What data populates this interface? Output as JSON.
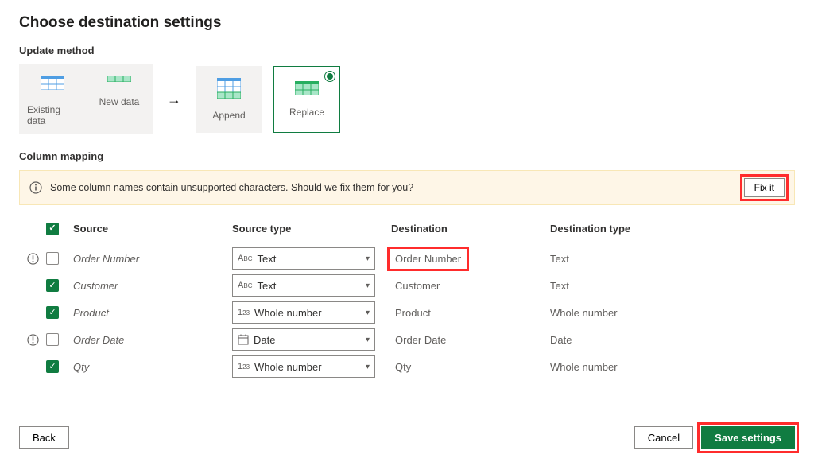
{
  "title": "Choose destination settings",
  "sections": {
    "update_method": "Update method",
    "column_mapping": "Column mapping"
  },
  "method": {
    "existing_data": "Existing data",
    "new_data": "New data",
    "append": "Append",
    "replace": "Replace"
  },
  "alert": {
    "message": "Some column names contain unsupported characters. Should we fix them for you?",
    "fix_label": "Fix it"
  },
  "table": {
    "headers": {
      "source": "Source",
      "source_type": "Source type",
      "destination": "Destination",
      "destination_type": "Destination type"
    },
    "rows": [
      {
        "checked": false,
        "warn": true,
        "source": "Order Number",
        "source_type": {
          "label": "Text",
          "icon": "abc"
        },
        "destination": "Order Number",
        "dest_type": "Text",
        "highlight_dest": true
      },
      {
        "checked": true,
        "warn": false,
        "source": "Customer",
        "source_type": {
          "label": "Text",
          "icon": "abc"
        },
        "destination": "Customer",
        "dest_type": "Text",
        "highlight_dest": false
      },
      {
        "checked": true,
        "warn": false,
        "source": "Product",
        "source_type": {
          "label": "Whole number",
          "icon": "123"
        },
        "destination": "Product",
        "dest_type": "Whole number",
        "highlight_dest": false
      },
      {
        "checked": false,
        "warn": true,
        "source": "Order Date",
        "source_type": {
          "label": "Date",
          "icon": "date"
        },
        "destination": "Order Date",
        "dest_type": "Date",
        "highlight_dest": false
      },
      {
        "checked": true,
        "warn": false,
        "source": "Qty",
        "source_type": {
          "label": "Whole number",
          "icon": "123"
        },
        "destination": "Qty",
        "dest_type": "Whole number",
        "highlight_dest": false
      }
    ]
  },
  "footer": {
    "back": "Back",
    "cancel": "Cancel",
    "save": "Save settings"
  }
}
